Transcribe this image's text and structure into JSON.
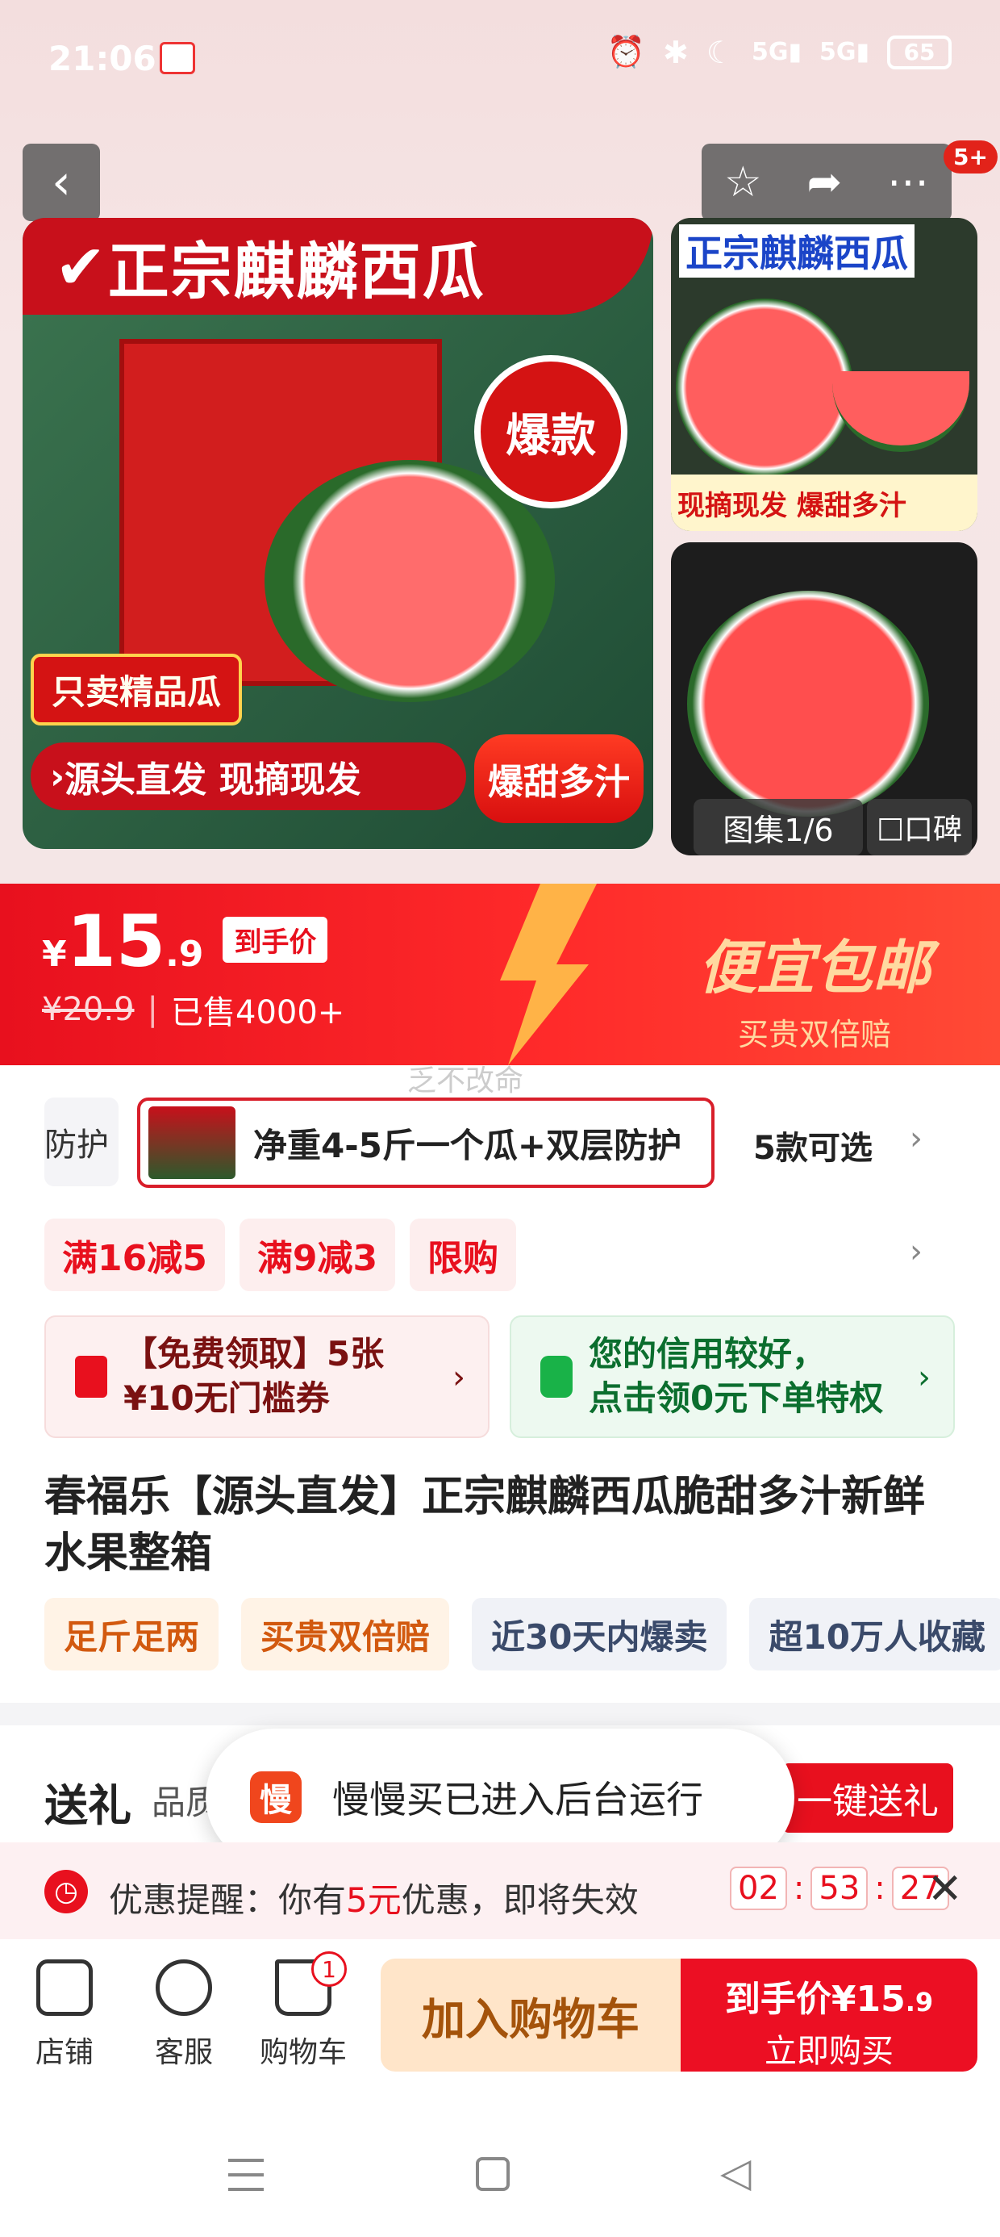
{
  "status_bar": {
    "time": "21:06",
    "network_1": "5G",
    "network_2": "5G",
    "battery": "65"
  },
  "top_nav": {
    "more_badge": "5+"
  },
  "gallery": {
    "main_image": {
      "banner_text": "正宗麒麟西瓜",
      "seal_text": "爆款",
      "tag_text": "只卖精品瓜",
      "bottom_text": "源头直发 现摘现发",
      "flame_text": "爆甜多汁"
    },
    "side_image_1": {
      "title": "正宗麒麟西瓜",
      "caption": "现摘现发 爆甜多汁"
    },
    "counter": "图集1/6",
    "review_label": "口碑"
  },
  "price": {
    "currency": "¥",
    "integer": "15",
    "decimal": ".9",
    "price_tag": "到手价",
    "original": "¥20.9",
    "sold": "已售4000+",
    "promo_title": "便宜包邮",
    "promo_sub": "买贵双倍赔",
    "accent_color": "#e8101e"
  },
  "watermark": "乏不改命",
  "sku": {
    "partial_label": "防护",
    "selected_label": "净重4-5斤一个瓜+双层防护",
    "more_label": "5款可选"
  },
  "promo_tags": [
    "满16减5",
    "满9减3",
    "限购"
  ],
  "coupons": {
    "free_coupon": {
      "line1": "【免费领取】5张",
      "line2": "¥10无门槛券"
    },
    "credit": {
      "line1": "您的信用较好，",
      "line2": "点击领0元下单特权"
    }
  },
  "product_title": "春福乐【源头直发】正宗麒麟西瓜脆甜多汁新鲜水果整箱",
  "features": [
    "足斤足两",
    "买贵双倍赔",
    "近30天内爆卖",
    "超10万人收藏"
  ],
  "gift": {
    "title": "送礼",
    "subtitle": "品质",
    "button": "一键送礼"
  },
  "toast": {
    "icon_text": "慢",
    "text": "慢慢买已进入后台运行"
  },
  "reminder": {
    "prefix": "优惠提醒：你有",
    "amount": "5元",
    "suffix": "优惠，即将失效",
    "timer": {
      "h": "02",
      "m": "53",
      "s": "27"
    }
  },
  "bottom_bar": {
    "shop": "店铺",
    "service": "客服",
    "cart": "购物车",
    "cart_count": "1",
    "add_to_cart": "加入购物车",
    "buy_price_label": "到手价¥15",
    "buy_price_decimal": ".9",
    "buy_now": "立即购买"
  }
}
